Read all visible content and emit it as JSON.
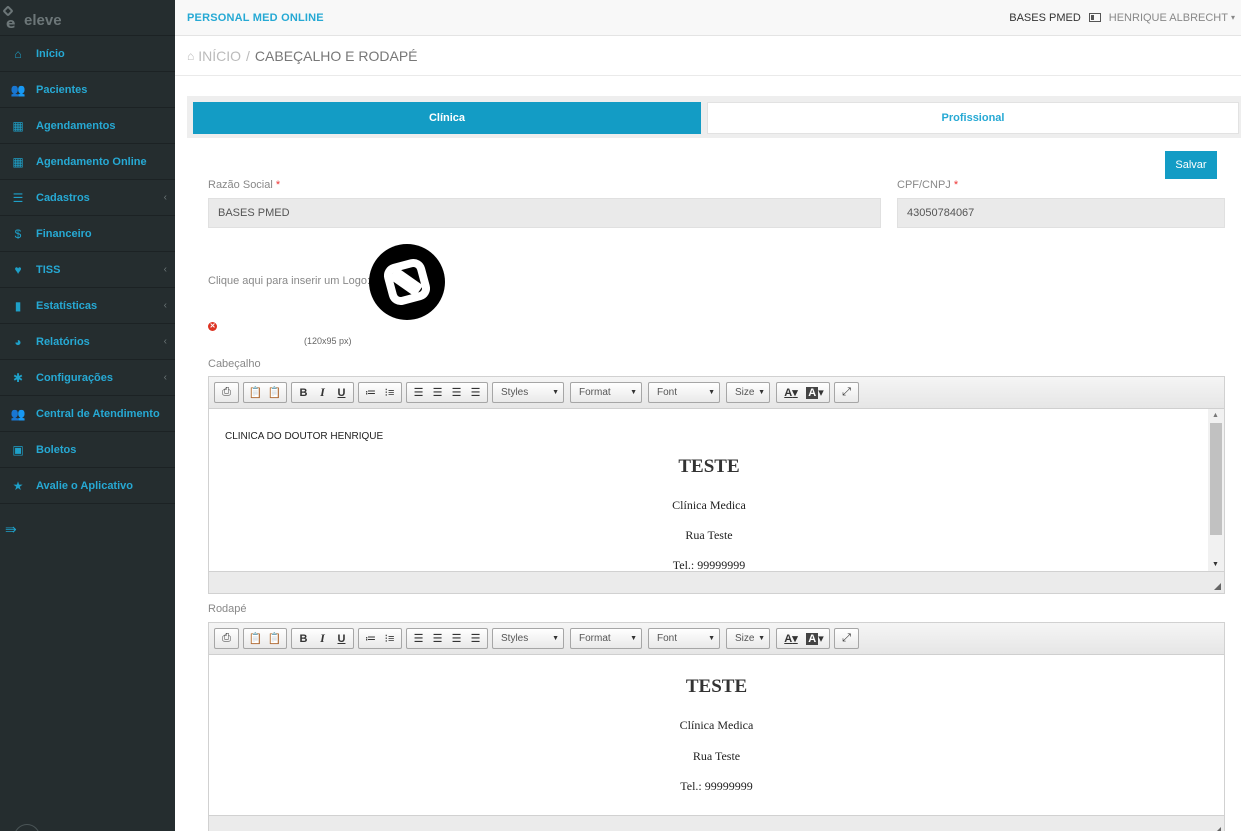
{
  "sidebar": {
    "logo_text": "eleve",
    "items": [
      {
        "label": "Início",
        "icon": "home-icon",
        "glyph": "⌂",
        "chevron": false
      },
      {
        "label": "Pacientes",
        "icon": "users-icon",
        "glyph": "👥",
        "chevron": false
      },
      {
        "label": "Agendamentos",
        "icon": "calendar-icon",
        "glyph": "▦",
        "chevron": false
      },
      {
        "label": "Agendamento Online",
        "icon": "calendar-icon",
        "glyph": "▦",
        "chevron": false
      },
      {
        "label": "Cadastros",
        "icon": "list-icon",
        "glyph": "☰",
        "chevron": true
      },
      {
        "label": "Financeiro",
        "icon": "dollar-icon",
        "glyph": "$",
        "chevron": false
      },
      {
        "label": "TISS",
        "icon": "heartbeat-icon",
        "glyph": "♥",
        "chevron": true
      },
      {
        "label": "Estatísticas",
        "icon": "bar-chart-icon",
        "glyph": "▮",
        "chevron": true
      },
      {
        "label": "Relatórios",
        "icon": "pie-chart-icon",
        "glyph": "◕",
        "chevron": true
      },
      {
        "label": "Configurações",
        "icon": "gear-icon",
        "glyph": "✱",
        "chevron": true
      },
      {
        "label": "Central de Atendimento",
        "icon": "users-icon",
        "glyph": "👥",
        "chevron": false
      },
      {
        "label": "Boletos",
        "icon": "money-icon",
        "glyph": "▣",
        "chevron": false
      },
      {
        "label": "Avalie o Aplicativo",
        "icon": "star-icon",
        "glyph": "★",
        "chevron": false
      }
    ],
    "collapse_glyph": "⇛"
  },
  "topbar": {
    "app_title": "PERSONAL MED ONLINE",
    "clinic": "BASES PMED",
    "user": "HENRIQUE ALBRECHT"
  },
  "breadcrumb": {
    "home": "INÍCIO",
    "separator": "/",
    "current": "CABEÇALHO E RODAPÉ"
  },
  "tabs": {
    "clinica": "Clínica",
    "profissional": "Profissional"
  },
  "form": {
    "save_label": "Salvar",
    "razao_label": "Razão Social",
    "razao_value": "BASES PMED",
    "cpf_label": "CPF/CNPJ",
    "cpf_value": "43050784067",
    "required_mark": "*",
    "logo_label": "Clique aqui para inserir um Logo:",
    "logo_size_hint": "(120x95 px)",
    "remove_glyph": "✕"
  },
  "editor_toolbar": {
    "styles": "Styles",
    "format": "Format",
    "font": "Font",
    "size": "Size",
    "bold": "B",
    "italic": "I",
    "underline": "U",
    "text_color": "A",
    "bg_color": "A"
  },
  "header_editor": {
    "label": "Cabeçalho",
    "clinic_line": "CLINICA DO DOUTOR HENRIQUE",
    "title": "TESTE",
    "line1": "Clínica Medica",
    "line2": "Rua Teste",
    "line3": "Tel.: 99999999"
  },
  "footer_editor": {
    "label": "Rodapé",
    "title": "TESTE",
    "line1": "Clínica Medica",
    "line2": "Rua Teste",
    "line3": "Tel.: 99999999"
  },
  "colors": {
    "sidebar_bg": "#252d2f",
    "accent": "#139cc5",
    "nav_text": "#26a9d4"
  }
}
